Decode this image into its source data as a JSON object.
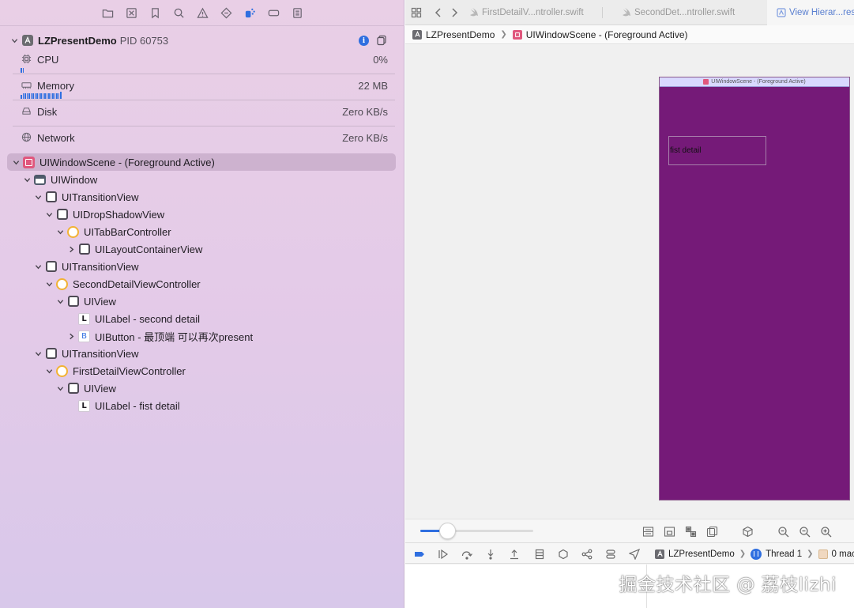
{
  "navigator": {
    "process": {
      "name": "LZPresentDemo",
      "pid": "PID 60753"
    },
    "gauges": [
      {
        "label": "CPU",
        "value": "0%"
      },
      {
        "label": "Memory",
        "value": "22 MB"
      },
      {
        "label": "Disk",
        "value": "Zero KB/s"
      },
      {
        "label": "Network",
        "value": "Zero KB/s"
      }
    ],
    "tree": [
      {
        "label": "UIWindowScene - (Foreground Active)",
        "icon": "scene-icon",
        "depth": 0,
        "disclosure": "expanded",
        "selected": true
      },
      {
        "label": "UIWindow",
        "icon": "window-icon",
        "depth": 1,
        "disclosure": "expanded"
      },
      {
        "label": "UITransitionView",
        "icon": "view-icon",
        "depth": 2,
        "disclosure": "expanded"
      },
      {
        "label": "UIDropShadowView",
        "icon": "view-icon",
        "depth": 3,
        "disclosure": "expanded"
      },
      {
        "label": "UITabBarController",
        "icon": "view-controller-icon",
        "depth": 4,
        "disclosure": "expanded"
      },
      {
        "label": "UILayoutContainerView",
        "icon": "view-icon",
        "depth": 5,
        "disclosure": "collapsed"
      },
      {
        "label": "UITransitionView",
        "icon": "view-icon",
        "depth": 2,
        "disclosure": "expanded"
      },
      {
        "label": "SecondDetailViewController",
        "icon": "view-controller-icon",
        "depth": 3,
        "disclosure": "expanded"
      },
      {
        "label": "UIView",
        "icon": "view-icon",
        "depth": 4,
        "disclosure": "expanded"
      },
      {
        "label": "UILabel - second detail",
        "icon": "label-icon",
        "badge": "L",
        "depth": 5,
        "disclosure": "none"
      },
      {
        "label": "UIButton - 最顶端 可以再次present",
        "icon": "button-icon",
        "badge": "B",
        "depth": 5,
        "disclosure": "collapsed"
      },
      {
        "label": "UITransitionView",
        "icon": "view-icon",
        "depth": 2,
        "disclosure": "expanded"
      },
      {
        "label": "FirstDetailViewController",
        "icon": "view-controller-icon",
        "depth": 3,
        "disclosure": "expanded"
      },
      {
        "label": "UIView",
        "icon": "view-icon",
        "depth": 4,
        "disclosure": "expanded"
      },
      {
        "label": "UILabel - fist detail",
        "icon": "label-icon",
        "badge": "L",
        "depth": 5,
        "disclosure": "none"
      }
    ]
  },
  "editor": {
    "tabs": [
      {
        "label": "FirstDetailV...ntroller.swift",
        "icon": "swift-file-icon",
        "active": false
      },
      {
        "label": "SecondDet...ntroller.swift",
        "icon": "swift-file-icon",
        "active": false
      },
      {
        "label": "View Hierar...res",
        "icon": "view-hierarchy-icon",
        "active": true
      }
    ],
    "jumpbar": {
      "app": "LZPresentDemo",
      "scene": "UIWindowScene - (Foreground Active)"
    },
    "canvas": {
      "device_title": "UIWindowScene - (Foreground Active)",
      "label_text": "fist detail",
      "device_color": "#751a78"
    },
    "zoom": {
      "slider_fraction": 0.24
    },
    "debug": {
      "app": "LZPresentDemo",
      "thread": "Thread 1",
      "frame": "0 mac"
    }
  },
  "watermark": "掘金技术社区 @ 荔枝lizhi",
  "colors": {
    "accent": "#2f6fe0",
    "selection": "#cdb2cf",
    "view_controller": "#f2b233",
    "scene": "#e0577d"
  }
}
